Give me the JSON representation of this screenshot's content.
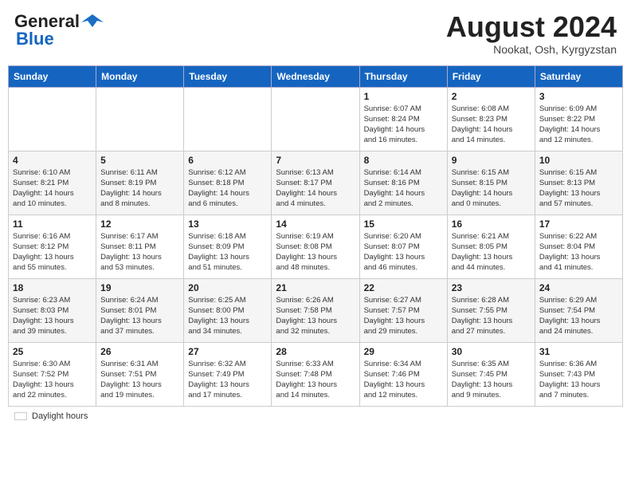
{
  "header": {
    "logo_line1": "General",
    "logo_line2": "Blue",
    "month_title": "August 2024",
    "subtitle": "Nookat, Osh, Kyrgyzstan"
  },
  "days_of_week": [
    "Sunday",
    "Monday",
    "Tuesday",
    "Wednesday",
    "Thursday",
    "Friday",
    "Saturday"
  ],
  "footer": {
    "legend_label": "Daylight hours"
  },
  "weeks": [
    [
      {
        "day": "",
        "info": ""
      },
      {
        "day": "",
        "info": ""
      },
      {
        "day": "",
        "info": ""
      },
      {
        "day": "",
        "info": ""
      },
      {
        "day": "1",
        "info": "Sunrise: 6:07 AM\nSunset: 8:24 PM\nDaylight: 14 hours\nand 16 minutes."
      },
      {
        "day": "2",
        "info": "Sunrise: 6:08 AM\nSunset: 8:23 PM\nDaylight: 14 hours\nand 14 minutes."
      },
      {
        "day": "3",
        "info": "Sunrise: 6:09 AM\nSunset: 8:22 PM\nDaylight: 14 hours\nand 12 minutes."
      }
    ],
    [
      {
        "day": "4",
        "info": "Sunrise: 6:10 AM\nSunset: 8:21 PM\nDaylight: 14 hours\nand 10 minutes."
      },
      {
        "day": "5",
        "info": "Sunrise: 6:11 AM\nSunset: 8:19 PM\nDaylight: 14 hours\nand 8 minutes."
      },
      {
        "day": "6",
        "info": "Sunrise: 6:12 AM\nSunset: 8:18 PM\nDaylight: 14 hours\nand 6 minutes."
      },
      {
        "day": "7",
        "info": "Sunrise: 6:13 AM\nSunset: 8:17 PM\nDaylight: 14 hours\nand 4 minutes."
      },
      {
        "day": "8",
        "info": "Sunrise: 6:14 AM\nSunset: 8:16 PM\nDaylight: 14 hours\nand 2 minutes."
      },
      {
        "day": "9",
        "info": "Sunrise: 6:15 AM\nSunset: 8:15 PM\nDaylight: 14 hours\nand 0 minutes."
      },
      {
        "day": "10",
        "info": "Sunrise: 6:15 AM\nSunset: 8:13 PM\nDaylight: 13 hours\nand 57 minutes."
      }
    ],
    [
      {
        "day": "11",
        "info": "Sunrise: 6:16 AM\nSunset: 8:12 PM\nDaylight: 13 hours\nand 55 minutes."
      },
      {
        "day": "12",
        "info": "Sunrise: 6:17 AM\nSunset: 8:11 PM\nDaylight: 13 hours\nand 53 minutes."
      },
      {
        "day": "13",
        "info": "Sunrise: 6:18 AM\nSunset: 8:09 PM\nDaylight: 13 hours\nand 51 minutes."
      },
      {
        "day": "14",
        "info": "Sunrise: 6:19 AM\nSunset: 8:08 PM\nDaylight: 13 hours\nand 48 minutes."
      },
      {
        "day": "15",
        "info": "Sunrise: 6:20 AM\nSunset: 8:07 PM\nDaylight: 13 hours\nand 46 minutes."
      },
      {
        "day": "16",
        "info": "Sunrise: 6:21 AM\nSunset: 8:05 PM\nDaylight: 13 hours\nand 44 minutes."
      },
      {
        "day": "17",
        "info": "Sunrise: 6:22 AM\nSunset: 8:04 PM\nDaylight: 13 hours\nand 41 minutes."
      }
    ],
    [
      {
        "day": "18",
        "info": "Sunrise: 6:23 AM\nSunset: 8:03 PM\nDaylight: 13 hours\nand 39 minutes."
      },
      {
        "day": "19",
        "info": "Sunrise: 6:24 AM\nSunset: 8:01 PM\nDaylight: 13 hours\nand 37 minutes."
      },
      {
        "day": "20",
        "info": "Sunrise: 6:25 AM\nSunset: 8:00 PM\nDaylight: 13 hours\nand 34 minutes."
      },
      {
        "day": "21",
        "info": "Sunrise: 6:26 AM\nSunset: 7:58 PM\nDaylight: 13 hours\nand 32 minutes."
      },
      {
        "day": "22",
        "info": "Sunrise: 6:27 AM\nSunset: 7:57 PM\nDaylight: 13 hours\nand 29 minutes."
      },
      {
        "day": "23",
        "info": "Sunrise: 6:28 AM\nSunset: 7:55 PM\nDaylight: 13 hours\nand 27 minutes."
      },
      {
        "day": "24",
        "info": "Sunrise: 6:29 AM\nSunset: 7:54 PM\nDaylight: 13 hours\nand 24 minutes."
      }
    ],
    [
      {
        "day": "25",
        "info": "Sunrise: 6:30 AM\nSunset: 7:52 PM\nDaylight: 13 hours\nand 22 minutes."
      },
      {
        "day": "26",
        "info": "Sunrise: 6:31 AM\nSunset: 7:51 PM\nDaylight: 13 hours\nand 19 minutes."
      },
      {
        "day": "27",
        "info": "Sunrise: 6:32 AM\nSunset: 7:49 PM\nDaylight: 13 hours\nand 17 minutes."
      },
      {
        "day": "28",
        "info": "Sunrise: 6:33 AM\nSunset: 7:48 PM\nDaylight: 13 hours\nand 14 minutes."
      },
      {
        "day": "29",
        "info": "Sunrise: 6:34 AM\nSunset: 7:46 PM\nDaylight: 13 hours\nand 12 minutes."
      },
      {
        "day": "30",
        "info": "Sunrise: 6:35 AM\nSunset: 7:45 PM\nDaylight: 13 hours\nand 9 minutes."
      },
      {
        "day": "31",
        "info": "Sunrise: 6:36 AM\nSunset: 7:43 PM\nDaylight: 13 hours\nand 7 minutes."
      }
    ]
  ]
}
